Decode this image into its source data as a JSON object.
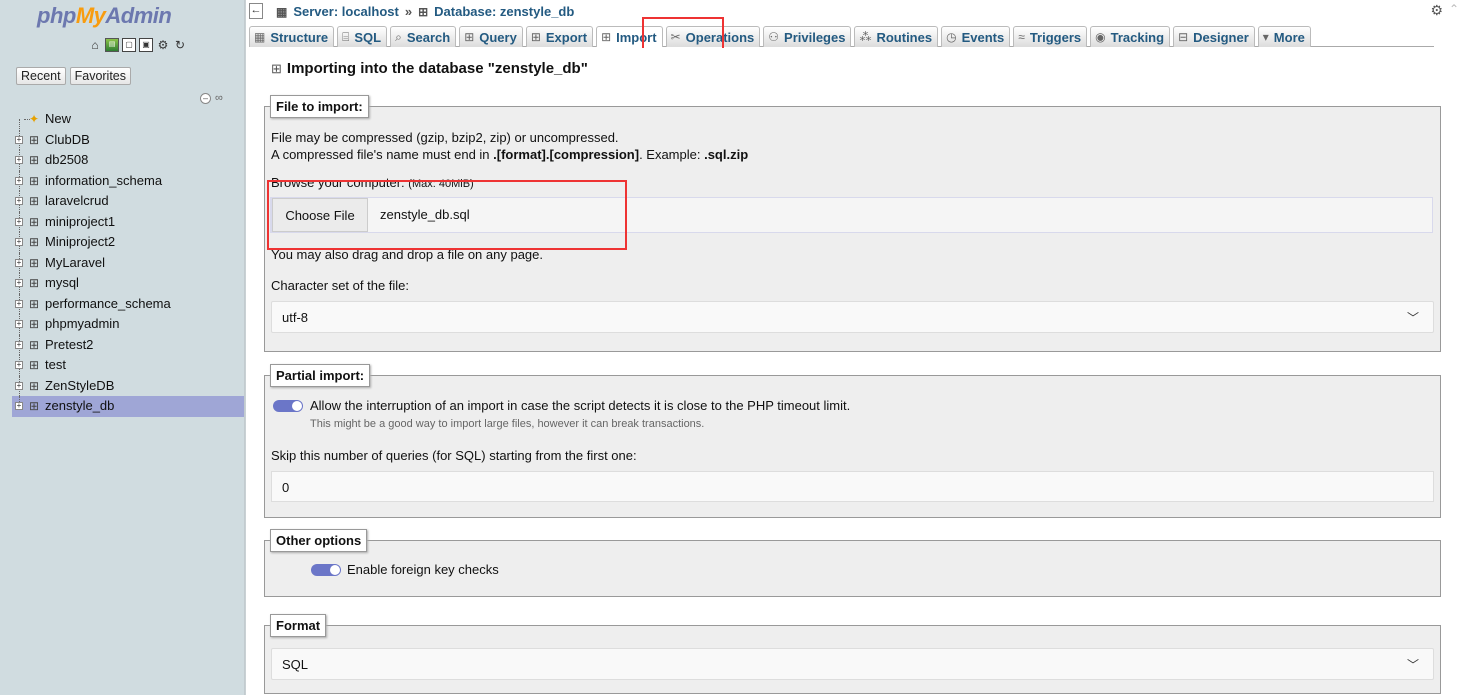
{
  "app": {
    "logo_php": "php",
    "logo_my": "My",
    "logo_admin": "Admin"
  },
  "sidebar": {
    "quick_icons": [
      "home-icon",
      "logout-icon",
      "sql-query-icon",
      "console-icon",
      "settings-icon",
      "reload-icon"
    ],
    "recent_label": "Recent",
    "favorites_label": "Favorites",
    "new_label": "New",
    "databases": [
      "ClubDB",
      "db2508",
      "information_schema",
      "laravelcrud",
      "miniproject1",
      "Miniproject2",
      "MyLaravel",
      "mysql",
      "performance_schema",
      "phpmyadmin",
      "Pretest2",
      "test",
      "ZenStyleDB",
      "zenstyle_db"
    ],
    "selected_database": "zenstyle_db"
  },
  "breadcrumb": {
    "server": "Server: localhost",
    "separator": "»",
    "database": "Database: zenstyle_db"
  },
  "tabs": [
    {
      "label": "Structure",
      "icon": "structure-icon"
    },
    {
      "label": "SQL",
      "icon": "sql-icon"
    },
    {
      "label": "Search",
      "icon": "search-icon"
    },
    {
      "label": "Query",
      "icon": "query-icon"
    },
    {
      "label": "Export",
      "icon": "export-icon"
    },
    {
      "label": "Import",
      "icon": "import-icon",
      "active": true
    },
    {
      "label": "Operations",
      "icon": "operations-icon"
    },
    {
      "label": "Privileges",
      "icon": "privileges-icon"
    },
    {
      "label": "Routines",
      "icon": "routines-icon"
    },
    {
      "label": "Events",
      "icon": "events-icon"
    },
    {
      "label": "Triggers",
      "icon": "triggers-icon"
    },
    {
      "label": "Tracking",
      "icon": "tracking-icon"
    },
    {
      "label": "Designer",
      "icon": "designer-icon"
    },
    {
      "label": "More",
      "icon": "chevron-down-icon"
    }
  ],
  "main": {
    "heading": "Importing into the database \"zenstyle_db\"",
    "file_to_import": {
      "legend": "File to import:",
      "line1": "File may be compressed (gzip, bzip2, zip) or uncompressed.",
      "line2_prefix": "A compressed file's name must end in ",
      "line2_bold1": ".[format].[compression]",
      "line2_mid": ". Example: ",
      "line2_bold2": ".sql.zip",
      "browse_label": "Browse your computer:",
      "browse_max": "(Max: 40MiB)",
      "choose_file_button": "Choose File",
      "file_name": "zenstyle_db.sql",
      "drag_drop_text": "You may also drag and drop a file on any page.",
      "charset_label": "Character set of the file:",
      "charset_value": "utf-8"
    },
    "partial_import": {
      "legend": "Partial import:",
      "allow_interrupt_label": "Allow the interruption of an import in case the script detects it is close to the PHP timeout limit.",
      "allow_interrupt_enabled": true,
      "allow_interrupt_hint": "This might be a good way to import large files, however it can break transactions.",
      "skip_label": "Skip this number of queries (for SQL) starting from the first one:",
      "skip_value": "0"
    },
    "other_options": {
      "legend": "Other options",
      "foreign_key_label": "Enable foreign key checks",
      "foreign_key_enabled": true
    },
    "format": {
      "legend": "Format",
      "value": "SQL"
    }
  },
  "colors": {
    "sidebar_bg": "#d0dce0",
    "selected_row": "#9fa6d6",
    "link_blue": "#235a81",
    "toggle_on": "#6b76c8",
    "highlight_red": "#e33333"
  }
}
